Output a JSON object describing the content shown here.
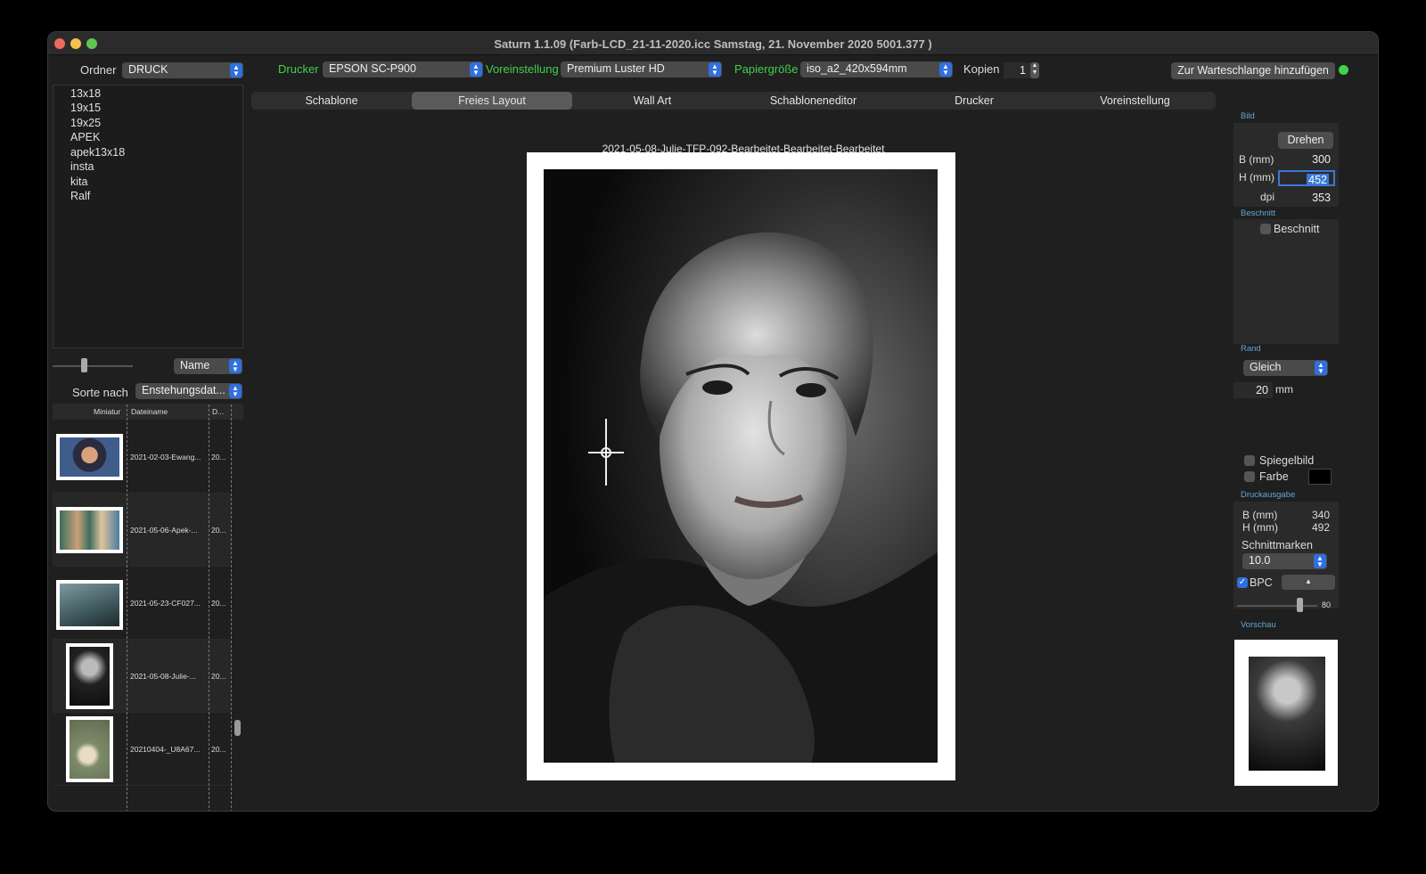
{
  "window": {
    "title": "Saturn 1.1.09 (Farb-LCD_21-11-2020.icc Samstag, 21. November 2020  5001.377 )"
  },
  "toolbar": {
    "folder_label": "Ordner",
    "folder_value": "DRUCK",
    "printer_label": "Drucker",
    "printer_value": "EPSON SC-P900",
    "preset_label": "Voreinstellung",
    "preset_value": "Premium Luster HD",
    "paper_label": "Papiergröße",
    "paper_value": "iso_a2_420x594mm",
    "copies_label": "Kopien",
    "copies_value": "1",
    "queue_button": "Zur Warteschlange hinzufügen",
    "status_color": "#3fd14a"
  },
  "folders": [
    "13x18",
    "19x15",
    "19x25",
    "APEK",
    "apek13x18",
    "insta",
    "kita",
    "Ralf"
  ],
  "sort": {
    "name_popup": "Name",
    "sort_label": "Sorte nach",
    "sort_value": "Enstehungsdat..."
  },
  "file_table": {
    "headers": [
      "Miniatur",
      "Dateiname",
      "D..."
    ],
    "rows": [
      {
        "name": "2021-02-03-Ewang...",
        "date": "20..."
      },
      {
        "name": "2021-05-06-Apek-...",
        "date": "20..."
      },
      {
        "name": "2021-05-23-CF027...",
        "date": "20..."
      },
      {
        "name": "2021-05-08-Julie-...",
        "date": "20..."
      },
      {
        "name": "20210404-_U8A67...",
        "date": "20..."
      }
    ]
  },
  "tabs": [
    "Schablone",
    "Freies Layout",
    "Wall Art",
    "Schabloneneditor",
    "Drucker",
    "Voreinstellung"
  ],
  "active_tab": "Freies Layout",
  "canvas": {
    "caption": "2021-05-08-Julie-TFP-092-Bearbeitet-Bearbeitet-Bearbeitet"
  },
  "right_panel": {
    "bild_title": "Bild",
    "rotate_button": "Drehen",
    "width_label": "B (mm)",
    "width_value": "300",
    "height_label": "H (mm)",
    "height_value": "452",
    "dpi_label": "dpi",
    "dpi_value": "353",
    "crop_title": "Beschnitt",
    "crop_checkbox": "Beschnitt",
    "margin_title": "Rand",
    "margin_mode": "Gleich",
    "margin_value": "20",
    "margin_unit": "mm",
    "mirror_label": "Spiegelbild",
    "color_label": "Farbe",
    "output_title": "Druckausgabe",
    "out_width_label": "B (mm)",
    "out_width_value": "340",
    "out_height_label": "H (mm)",
    "out_height_value": "492",
    "cutmarks_label": "Schnittmarken",
    "cutmarks_value": "10.0",
    "bpc_label": "BPC",
    "slider_value": "80",
    "preview_title": "Vorschau"
  }
}
